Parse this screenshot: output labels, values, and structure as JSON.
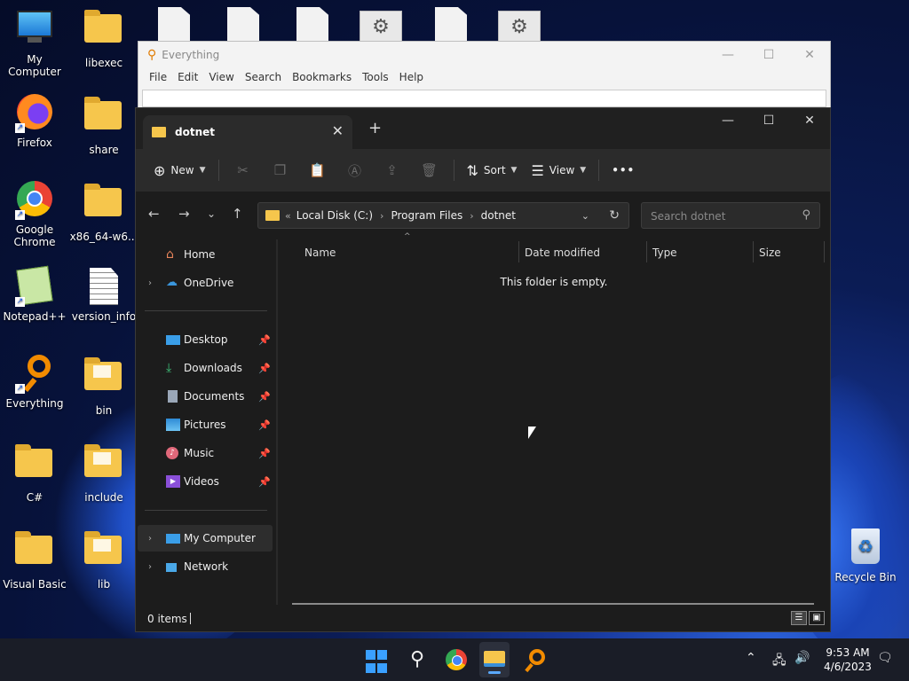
{
  "desktop": {
    "icons": [
      {
        "label": "My Computer",
        "kind": "computer"
      },
      {
        "label": "libexec",
        "kind": "folder"
      },
      {
        "label": "Firefox",
        "kind": "firefox"
      },
      {
        "label": "share",
        "kind": "folder"
      },
      {
        "label": "Google Chrome",
        "kind": "chrome"
      },
      {
        "label": "x86_64-w6...",
        "kind": "folder"
      },
      {
        "label": "Notepad++",
        "kind": "notepadpp"
      },
      {
        "label": "version_info",
        "kind": "document"
      },
      {
        "label": "Everything",
        "kind": "everything"
      },
      {
        "label": "bin",
        "kind": "folder"
      },
      {
        "label": "C#",
        "kind": "folder"
      },
      {
        "label": "include",
        "kind": "folder"
      },
      {
        "label": "Visual Basic",
        "kind": "folder"
      },
      {
        "label": "lib",
        "kind": "folder"
      },
      {
        "label": "Recycle Bin",
        "kind": "recycle-bin"
      }
    ]
  },
  "everything_window": {
    "title": "Everything",
    "menu": [
      "File",
      "Edit",
      "View",
      "Search",
      "Bookmarks",
      "Tools",
      "Help"
    ]
  },
  "explorer": {
    "tab_title": "dotnet",
    "toolbar": {
      "new_label": "New",
      "sort_label": "Sort",
      "view_label": "View",
      "more_label": "•••"
    },
    "breadcrumb": [
      "Local Disk (C:)",
      "Program Files",
      "dotnet"
    ],
    "breadcrumb_prefix": "«",
    "search_placeholder": "Search dotnet",
    "sidebar": {
      "home": "Home",
      "onedrive": "OneDrive",
      "desktop": "Desktop",
      "downloads": "Downloads",
      "documents": "Documents",
      "pictures": "Pictures",
      "music": "Music",
      "videos": "Videos",
      "my_computer": "My Computer",
      "network": "Network"
    },
    "columns": [
      "Name",
      "Date modified",
      "Type",
      "Size"
    ],
    "empty_message": "This folder is empty.",
    "status": "0 items"
  },
  "taskbar": {
    "time": "9:53 AM",
    "date": "4/6/2023"
  },
  "colors": {
    "folder": "#f6c64c",
    "explorer_bg": "#1c1c1c",
    "accent": "#3aa0ff"
  }
}
